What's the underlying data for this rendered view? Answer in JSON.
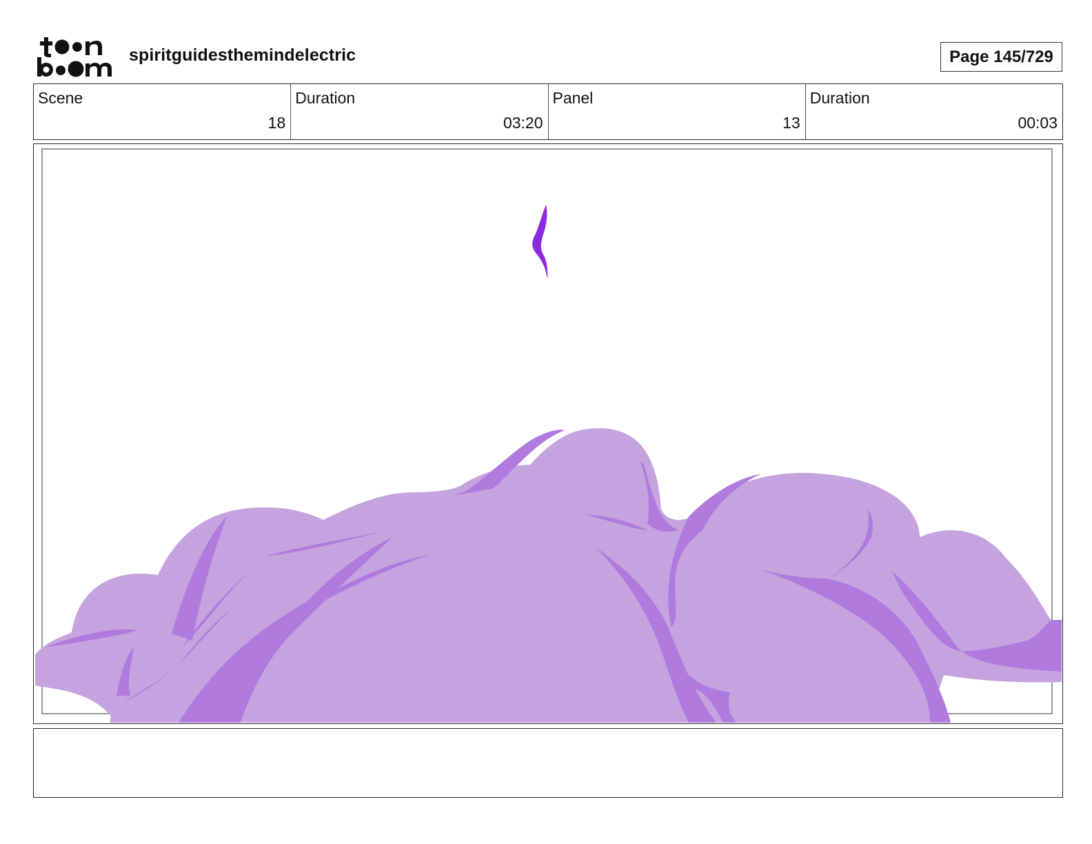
{
  "header": {
    "logo_text": "toon boom",
    "project_title": "spiritguidesthemindelectric",
    "page_label": "Page 145/729"
  },
  "info": {
    "scene_label": "Scene",
    "scene_value": "18",
    "scene_duration_label": "Duration",
    "scene_duration_value": "03:20",
    "panel_label": "Panel",
    "panel_value": "13",
    "panel_duration_label": "Duration",
    "panel_duration_value": "00:03"
  },
  "panel": {
    "colors": {
      "cloud_light": "#c4a3df",
      "cloud_shadow": "#b07adf",
      "streak": "#8a2be2"
    }
  },
  "notes": {
    "text": ""
  }
}
